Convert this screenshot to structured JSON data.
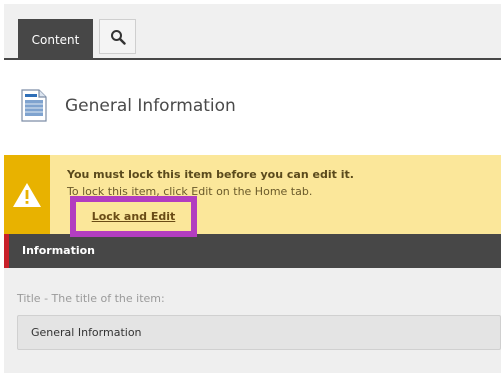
{
  "toolbar": {
    "content_tab_label": "Content",
    "search_icon": "search-icon"
  },
  "header": {
    "title": "General Information",
    "icon": "document-icon"
  },
  "warning": {
    "title": "You must lock this item before you can edit it.",
    "subtitle": "To lock this item, click Edit on the Home tab.",
    "action_label": "Lock and Edit",
    "icon": "warning-icon",
    "colors": {
      "background": "#fbe79a",
      "side": "#e8b200",
      "highlight": "#b23dc0"
    }
  },
  "section": {
    "title": "Information"
  },
  "field": {
    "label": "Title - The title of the item:",
    "value": "General Information"
  }
}
